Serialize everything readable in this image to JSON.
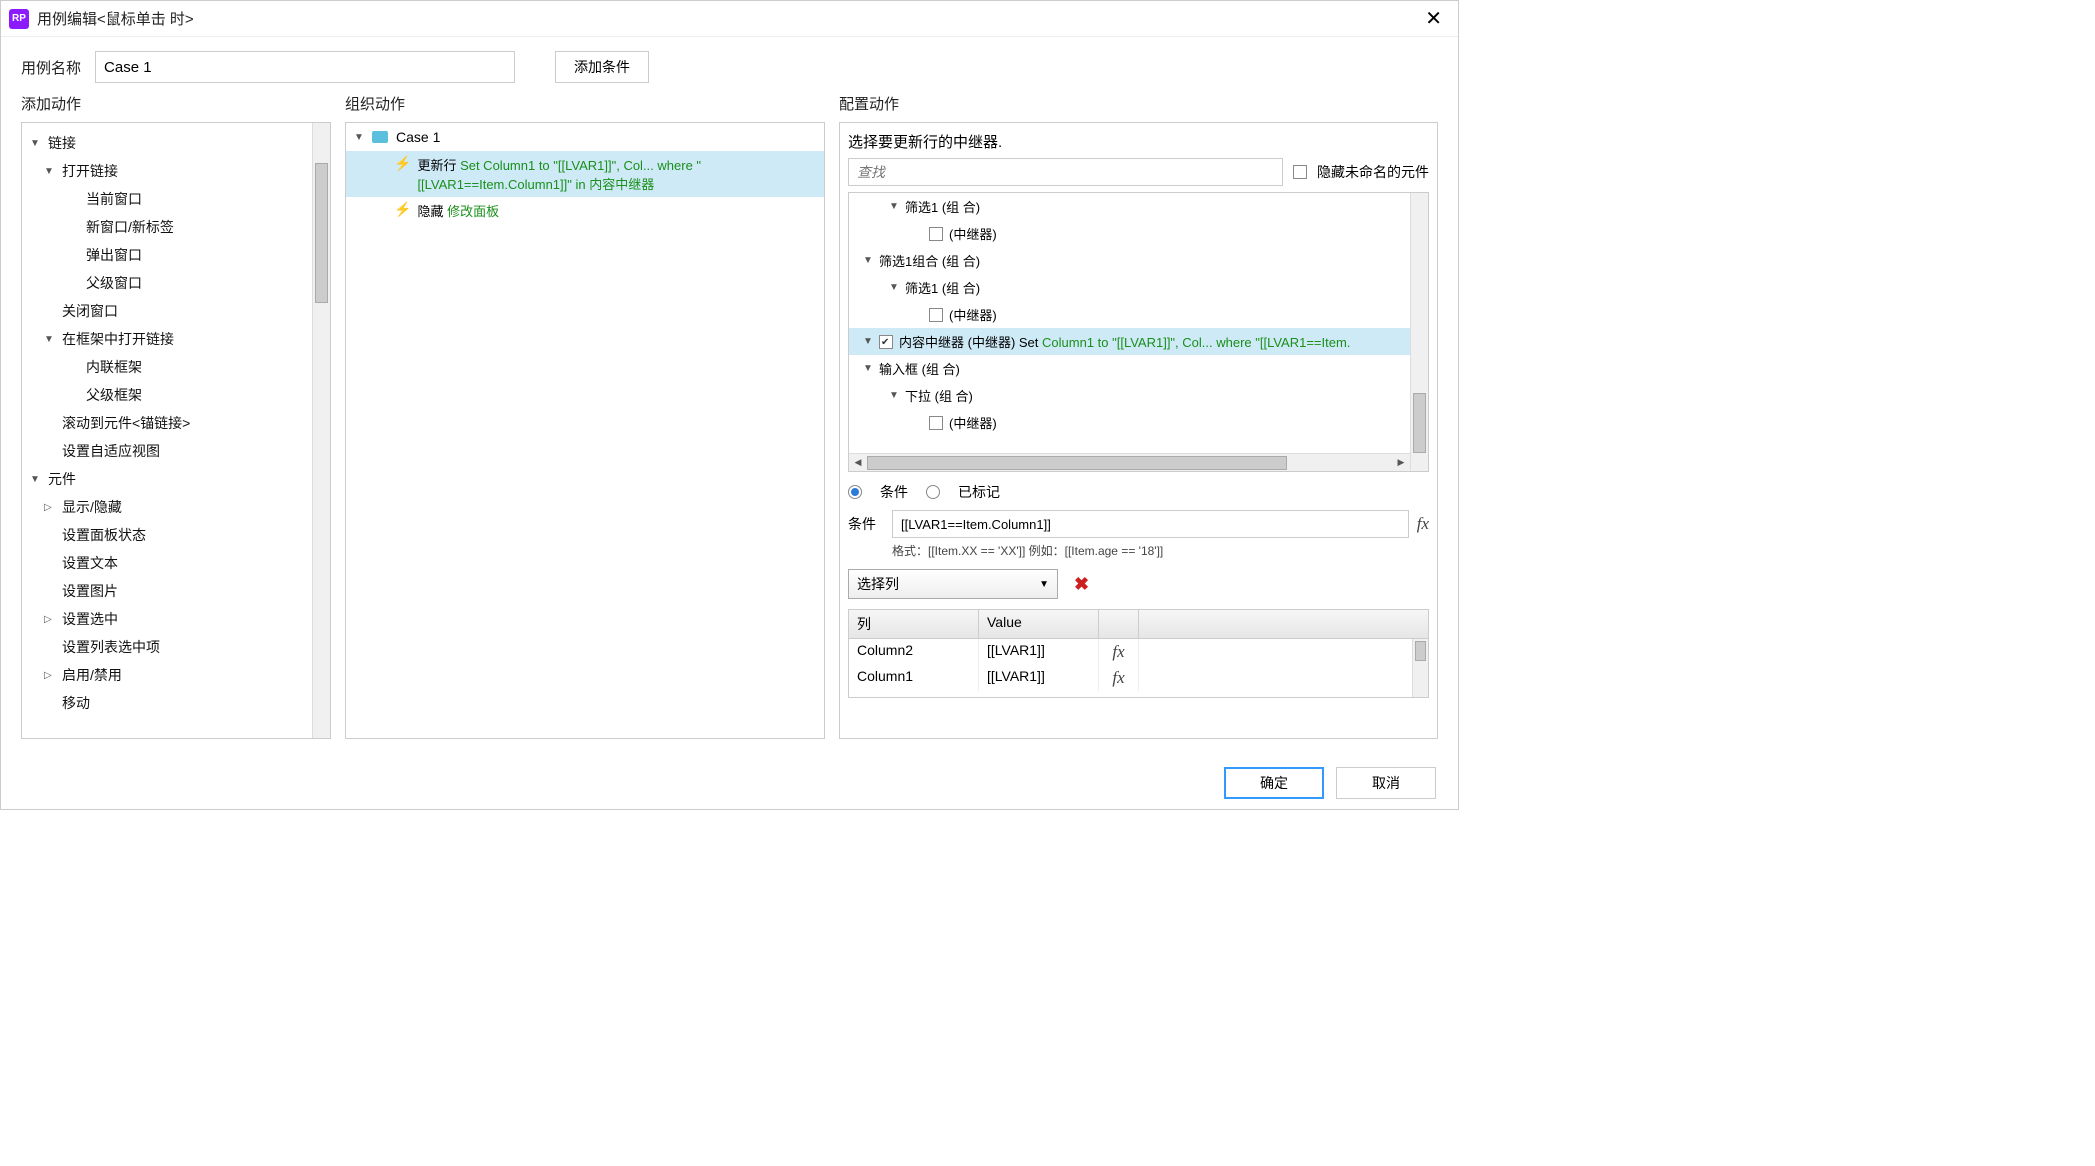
{
  "title": "用例编辑<鼠标单击 时>",
  "caseNameLabel": "用例名称",
  "caseName": "Case 1",
  "addConditionBtn": "添加条件",
  "headers": {
    "addAction": "添加动作",
    "organize": "组织动作",
    "configure": "配置动作"
  },
  "actionTree": [
    {
      "level": 0,
      "expand": "open",
      "label": "链接"
    },
    {
      "level": 1,
      "expand": "open",
      "label": "打开链接"
    },
    {
      "level": 2,
      "expand": "none",
      "label": "当前窗口"
    },
    {
      "level": 2,
      "expand": "none",
      "label": "新窗口/新标签"
    },
    {
      "level": 2,
      "expand": "none",
      "label": "弹出窗口"
    },
    {
      "level": 2,
      "expand": "none",
      "label": "父级窗口"
    },
    {
      "level": 1,
      "expand": "none",
      "label": "关闭窗口"
    },
    {
      "level": 1,
      "expand": "open",
      "label": "在框架中打开链接"
    },
    {
      "level": 2,
      "expand": "none",
      "label": "内联框架"
    },
    {
      "level": 2,
      "expand": "none",
      "label": "父级框架"
    },
    {
      "level": 1,
      "expand": "none",
      "label": "滚动到元件<锚链接>"
    },
    {
      "level": 1,
      "expand": "none",
      "label": "设置自适应视图"
    },
    {
      "level": 0,
      "expand": "open",
      "label": "元件"
    },
    {
      "level": 1,
      "expand": "closed",
      "label": "显示/隐藏"
    },
    {
      "level": 1,
      "expand": "none",
      "label": "设置面板状态"
    },
    {
      "level": 1,
      "expand": "none",
      "label": "设置文本"
    },
    {
      "level": 1,
      "expand": "none",
      "label": "设置图片"
    },
    {
      "level": 1,
      "expand": "closed",
      "label": "设置选中"
    },
    {
      "level": 1,
      "expand": "none",
      "label": "设置列表选中项"
    },
    {
      "level": 1,
      "expand": "closed",
      "label": "启用/禁用"
    },
    {
      "level": 1,
      "expand": "none",
      "label": "移动"
    }
  ],
  "organize": {
    "caseLabel": "Case 1",
    "actions": [
      {
        "selected": true,
        "name": "更新行",
        "detail": "Set Column1 to \"[[LVAR1]]\", Col... where \"[[LVAR1==Item.Column1]]\" in 内容中继器"
      },
      {
        "selected": false,
        "name": "隐藏",
        "detail": "修改面板"
      }
    ]
  },
  "configure": {
    "title": "选择要更新行的中继器.",
    "searchPlaceholder": "查找",
    "hideUnnamed": "隐藏未命名的元件",
    "tree": [
      {
        "indent": 40,
        "arrow": true,
        "chk": false,
        "label": "筛选1 (组 合)"
      },
      {
        "indent": 80,
        "arrow": false,
        "chk": true,
        "checked": false,
        "label": "(中继器)"
      },
      {
        "indent": 14,
        "arrow": true,
        "chk": false,
        "label": "筛选1组合 (组 合)"
      },
      {
        "indent": 40,
        "arrow": true,
        "chk": false,
        "label": "筛选1 (组 合)"
      },
      {
        "indent": 80,
        "arrow": false,
        "chk": true,
        "checked": false,
        "label": "(中继器)"
      },
      {
        "indent": 14,
        "arrow": true,
        "chk": false,
        "selected": true,
        "checked": true,
        "chkBox": true,
        "label": "内容中继器 (中继器) Set",
        "green": "Column1 to \"[[LVAR1]]\", Col... where \"[[LVAR1==Item."
      },
      {
        "indent": 14,
        "arrow": true,
        "chk": false,
        "label": "输入框 (组 合)"
      },
      {
        "indent": 40,
        "arrow": true,
        "chk": false,
        "label": "下拉 (组 合)"
      },
      {
        "indent": 80,
        "arrow": false,
        "chk": true,
        "checked": false,
        "label": "(中继器)"
      }
    ],
    "radioCondition": "条件",
    "radioMarked": "已标记",
    "condLabel": "条件",
    "condValue": "[[LVAR1==Item.Column1]]",
    "hint": "格式：[[Item.XX == 'XX']] 例如：[[Item.age == '18']]",
    "selectCol": "选择列",
    "gridHead": {
      "col": "列",
      "val": "Value"
    },
    "gridRows": [
      {
        "col": "Column1",
        "val": "[[LVAR1]]"
      },
      {
        "col": "Column2",
        "val": "[[LVAR1]]"
      }
    ]
  },
  "ok": "确定",
  "cancel": "取消"
}
